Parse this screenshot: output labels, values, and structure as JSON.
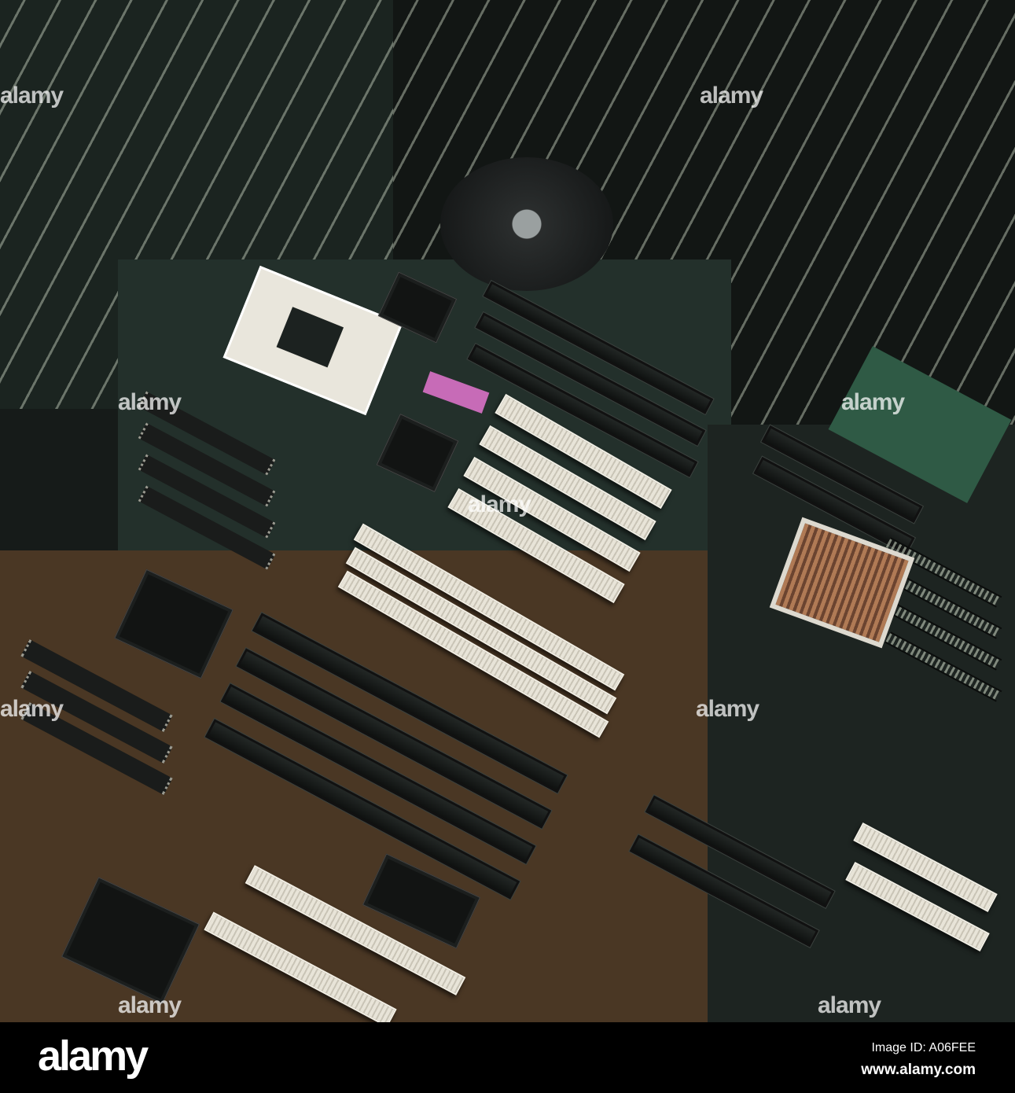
{
  "photo": {
    "subject": "Computer motherboards",
    "watermark": "alamy",
    "colors": {
      "background": "#161b19",
      "pcb_green": "#2a3a33",
      "pcb_brown": "#5a4329",
      "slot_white": "#e8e4d8"
    }
  },
  "footer": {
    "logo": "alamy",
    "image_id": "Image ID: A06FEE",
    "website": "www.alamy.com"
  }
}
